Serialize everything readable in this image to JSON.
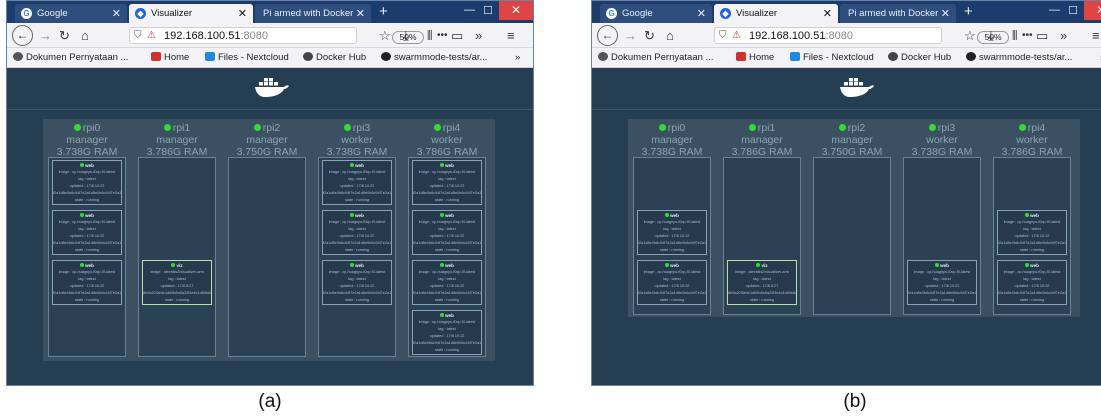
{
  "browser": {
    "tabs": [
      "Google",
      "Visualizer",
      "Pi armed with Docker"
    ],
    "url_host": "192.168.100.51",
    "url_port": ":8080",
    "zoom": "50%",
    "bookmarks": [
      "Dokumen Pernyataan ...",
      "Home",
      "Files - Nextcloud",
      "Docker Hub",
      "swarmmode-tests/ar..."
    ]
  },
  "task_text": {
    "image": "image : cp-huagnyu-f0cp-f0-latest",
    "tag": "tag : latest",
    "updated": "updated : 17/8 10:22",
    "id": "f2a1d8e0b6c94f7e2a1d8e0b6c94f7e2a1d8",
    "state": "state : running"
  },
  "viz_text": {
    "image": "image : alexellis2/visualizer-arm",
    "tag": "tag : latest",
    "updated": "updated : 17/8 8:27",
    "id": "8b5a20f3e4c1d69b8a5a20f3e4c1d69b8a5a",
    "state": "state : running"
  },
  "panels": [
    {
      "caption": "(a)",
      "nodes": [
        {
          "name": "rpi0",
          "role": "manager",
          "ram": "3.738G RAM",
          "tasks": [
            "web",
            "web",
            "web"
          ],
          "slots": [
            0,
            1,
            2
          ]
        },
        {
          "name": "rpi1",
          "role": "manager",
          "ram": "3.786G RAM",
          "tasks": [
            "viz"
          ],
          "slots": [
            2
          ]
        },
        {
          "name": "rpi2",
          "role": "manager",
          "ram": "3.750G RAM",
          "tasks": [],
          "slots": []
        },
        {
          "name": "rpi3",
          "role": "worker",
          "ram": "3.738G RAM",
          "tasks": [
            "web",
            "web",
            "web"
          ],
          "slots": [
            0,
            1,
            2
          ]
        },
        {
          "name": "rpi4",
          "role": "worker",
          "ram": "3.786G RAM",
          "tasks": [
            "web",
            "web",
            "web",
            "web"
          ],
          "slots": [
            0,
            1,
            2,
            3
          ]
        }
      ]
    },
    {
      "caption": "(b)",
      "nodes": [
        {
          "name": "rpi0",
          "role": "manager",
          "ram": "3.738G RAM",
          "tasks": [
            "web",
            "web"
          ],
          "slots": [
            1,
            2
          ]
        },
        {
          "name": "rpi1",
          "role": "manager",
          "ram": "3.786G RAM",
          "tasks": [
            "viz"
          ],
          "slots": [
            2
          ]
        },
        {
          "name": "rpi2",
          "role": "manager",
          "ram": "3.750G RAM",
          "tasks": [],
          "slots": []
        },
        {
          "name": "rpi3",
          "role": "worker",
          "ram": "3.738G RAM",
          "tasks": [
            "web"
          ],
          "slots": [
            2
          ]
        },
        {
          "name": "rpi4",
          "role": "worker",
          "ram": "3.786G RAM",
          "tasks": [
            "web",
            "web"
          ],
          "slots": [
            1,
            2
          ]
        }
      ]
    }
  ],
  "colors": {
    "node_dot": "#2ee02e",
    "page_bg": "#263e52",
    "cluster_bg": "#3b5061",
    "tabstrip": "#1c3c6e",
    "close_button": "#e04343"
  },
  "icons": [
    "back-icon",
    "forward-icon",
    "reload-icon",
    "home-icon",
    "shield-icon",
    "lock-insecure-icon",
    "more-icon",
    "bookmark-star-icon",
    "download-icon",
    "library-icon",
    "sidebar-icon",
    "overflow-icon",
    "menu-icon",
    "docker-whale-icon"
  ]
}
